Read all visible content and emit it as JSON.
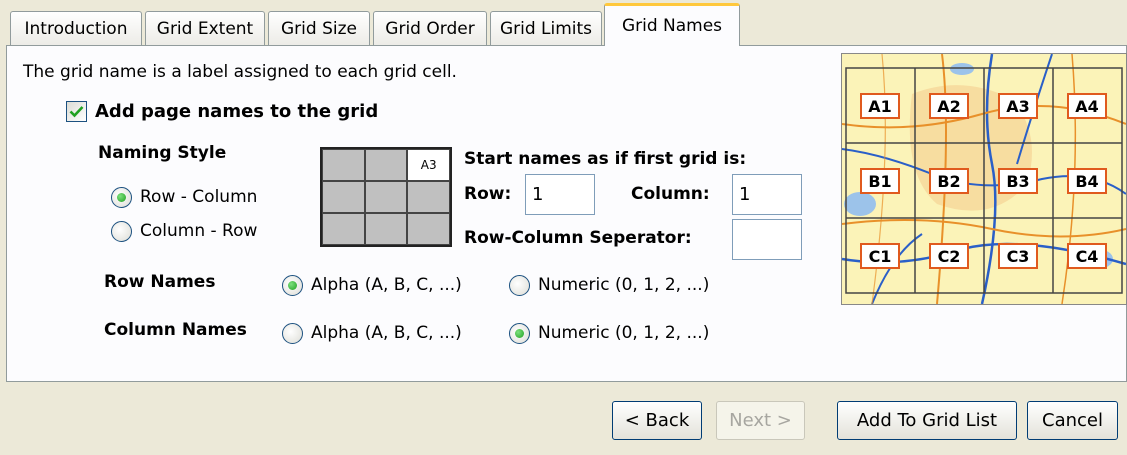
{
  "tabs": [
    {
      "label": "Introduction"
    },
    {
      "label": "Grid Extent"
    },
    {
      "label": "Grid Size"
    },
    {
      "label": "Grid Order"
    },
    {
      "label": "Grid Limits"
    },
    {
      "label": "Grid Names",
      "active": true
    }
  ],
  "description": "The grid name is a label assigned to each grid cell.",
  "add_page_names": {
    "label": "Add page names to the grid",
    "checked": true
  },
  "naming_style": {
    "heading": "Naming Style",
    "options": [
      {
        "label": "Row - Column",
        "selected": true
      },
      {
        "label": "Column - Row",
        "selected": false
      }
    ]
  },
  "preview_grid": {
    "highlight_label": "A3"
  },
  "start_names": {
    "heading": "Start names as if first grid is:",
    "row_label": "Row:",
    "row_value": "1",
    "column_label": "Column:",
    "column_value": "1",
    "separator_label": "Row-Column Seperator:",
    "separator_value": ""
  },
  "row_names": {
    "label": "Row Names",
    "alpha_label": "Alpha (A, B, C, ...)",
    "numeric_label": "Numeric (0, 1, 2, ...)",
    "selected": "alpha"
  },
  "column_names": {
    "label": "Column Names",
    "alpha_label": "Alpha (A, B, C, ...)",
    "numeric_label": "Numeric (0, 1, 2, ...)",
    "selected": "numeric"
  },
  "map_preview": {
    "cells": [
      "A1",
      "A2",
      "A3",
      "A4",
      "B1",
      "B2",
      "B3",
      "B4",
      "C1",
      "C2",
      "C3",
      "C4"
    ]
  },
  "buttons": {
    "back": "< Back",
    "next": "Next >",
    "add_to_grid_list": "Add To Grid List",
    "cancel": "Cancel"
  },
  "colors": {
    "dialog_bg": "#ECE9D8",
    "panel_bg": "#FCFCFE",
    "tab_accent": "#FFC83C",
    "radio_dot": "#21A121",
    "check_mark": "#21A121",
    "map_label_border": "#E05A1E",
    "map_road_blue": "#2A5FC8",
    "map_road_orange": "#E8902A"
  }
}
